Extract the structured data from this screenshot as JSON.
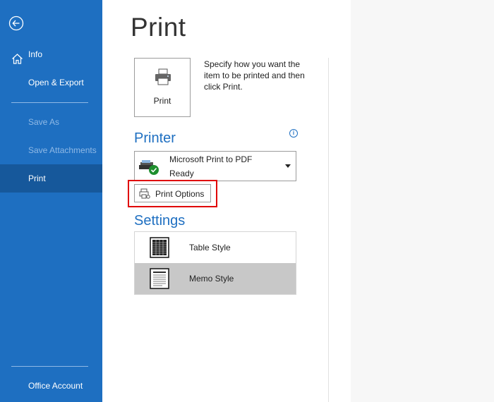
{
  "sidebar": {
    "items": {
      "info": "Info",
      "open_export": "Open & Export",
      "save_as": "Save As",
      "save_attachments": "Save Attachments",
      "print": "Print",
      "office_account": "Office Account"
    },
    "active": "Print"
  },
  "main": {
    "title": "Print",
    "print_button_label": "Print",
    "print_description": "Specify how you want the item to be printed and then click Print.",
    "printer": {
      "heading": "Printer",
      "selected_name": "Microsoft Print to PDF",
      "status": "Ready",
      "options_button": "Print Options"
    },
    "settings": {
      "heading": "Settings",
      "styles": [
        "Table Style",
        "Memo Style"
      ],
      "selected": "Memo Style"
    }
  },
  "colors": {
    "sidebar_bg": "#1e6fc1",
    "sidebar_active": "#16589b",
    "accent_text": "#1e6fc1",
    "highlight": "#e00000",
    "selected_row": "#c8c8c8"
  },
  "icons": [
    "back-arrow-icon",
    "home-icon",
    "printer-icon",
    "info-icon",
    "printer-ready-icon",
    "chevron-down-icon",
    "print-options-icon",
    "table-style-icon",
    "memo-style-icon"
  ]
}
